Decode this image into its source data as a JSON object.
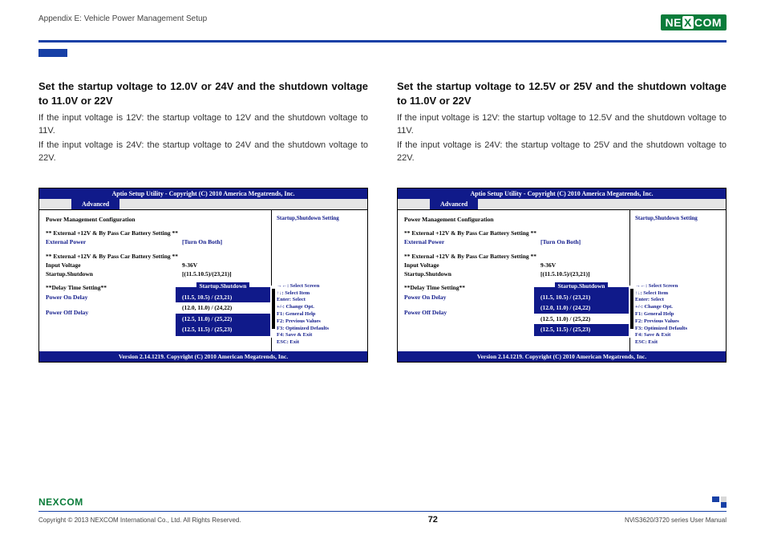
{
  "header": {
    "appendix": "Appendix E: Vehicle Power Management Setup",
    "logo_pre": "NE",
    "logo_x": "X",
    "logo_post": "COM"
  },
  "left": {
    "title": "Set the startup voltage to 12.0V or 24V and the shutdown voltage to 11.0V or 22V",
    "p1": "If the input voltage is 12V: the startup voltage to 12V and the shutdown voltage to 11V.",
    "p2": "If the input voltage is 24V: the startup voltage to 24V and the shutdown voltage to 22V."
  },
  "right": {
    "title": "Set the startup voltage to 12.5V or 25V and the shutdown voltage to 11.0V or 22V",
    "p1": "If the input voltage is 12V: the startup voltage to 12.5V and the shutdown voltage to 11V.",
    "p2": "If the input voltage is 24V: the startup voltage to 25V and the shutdown voltage to 22V."
  },
  "bios": {
    "title": "Aptio Setup Utility - Copyright (C) 2010 America Megatrends, Inc.",
    "tab": "Advanced",
    "section_header": "Power Management Configuration",
    "row1_lbl": "** External +12V & By Pass Car Battery Setting **",
    "row2_lbl": "External Power",
    "row2_val": "[Turn On Both]",
    "row3_lbl": "** External +12V & By Pass Car Battery Setting **",
    "row4_lbl": "Input Voltage",
    "row4_val": "9-36V",
    "row5_lbl": "Startup.Shutdown",
    "row5_val": "[(11.5.10.5)/(23,21)]",
    "row6_lbl": "**Delay Time Setting**",
    "row7_lbl": "Power On Delay",
    "row8_lbl": "Power Off Delay",
    "right_top": "Startup,Shutdown Setting",
    "help": [
      "→←: Select Screen",
      "↑↓: Select Item",
      "Enter: Select",
      "+/-: Change Opt.",
      "F1: General Help",
      "F2: Previous Values",
      "F3: Optimized Defaults",
      "F4: Save & Exit",
      "ESC: Exit"
    ],
    "popup_title": "Startup.Shutdown",
    "popup_options": [
      "(11.5, 10.5) / (23,21)",
      "(12.0, 11.0) / (24,22)",
      "(12.5, 11.0) / (25,22)",
      "(12.5, 11.5) / (25,23)"
    ],
    "footer": "Version 2.14.1219. Copyright (C) 2010 American Megatrends, Inc."
  },
  "left_selected_index": 1,
  "right_selected_index": 2,
  "footer": {
    "copyright": "Copyright © 2013 NEXCOM International Co., Ltd. All Rights Reserved.",
    "page": "72",
    "manual": "NViS3620/3720 series User Manual"
  }
}
